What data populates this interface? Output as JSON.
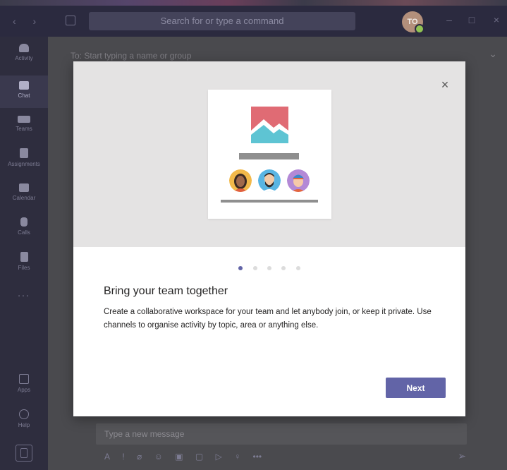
{
  "titlebar": {
    "search_placeholder": "Search for or type a command",
    "user_initials": "TO"
  },
  "rail": {
    "items": [
      {
        "label": "Activity",
        "icon": "bell-icon"
      },
      {
        "label": "Chat",
        "icon": "chat-icon",
        "active": true
      },
      {
        "label": "Teams",
        "icon": "teams-icon"
      },
      {
        "label": "Assignments",
        "icon": "assignments-icon"
      },
      {
        "label": "Calendar",
        "icon": "calendar-icon"
      },
      {
        "label": "Calls",
        "icon": "phone-icon"
      },
      {
        "label": "Files",
        "icon": "file-icon"
      }
    ],
    "more": "...",
    "bottom_items": [
      {
        "label": "Apps",
        "icon": "apps-icon"
      },
      {
        "label": "Help",
        "icon": "help-icon"
      }
    ]
  },
  "chat": {
    "to_label": "To:",
    "to_placeholder": "Start typing a name or group",
    "compose_placeholder": "Type a new message"
  },
  "modal": {
    "title": "Bring your team together",
    "body": "Create a collaborative workspace for your team and let anybody join, or keep it private. Use channels to organise activity by topic, area or anything else.",
    "next_label": "Next",
    "close_label": "×",
    "page_count": 5,
    "active_page": 1
  },
  "colors": {
    "accent": "#6264a7",
    "titlebar": "#2b2a3f",
    "rail": "#2e2d3e"
  }
}
